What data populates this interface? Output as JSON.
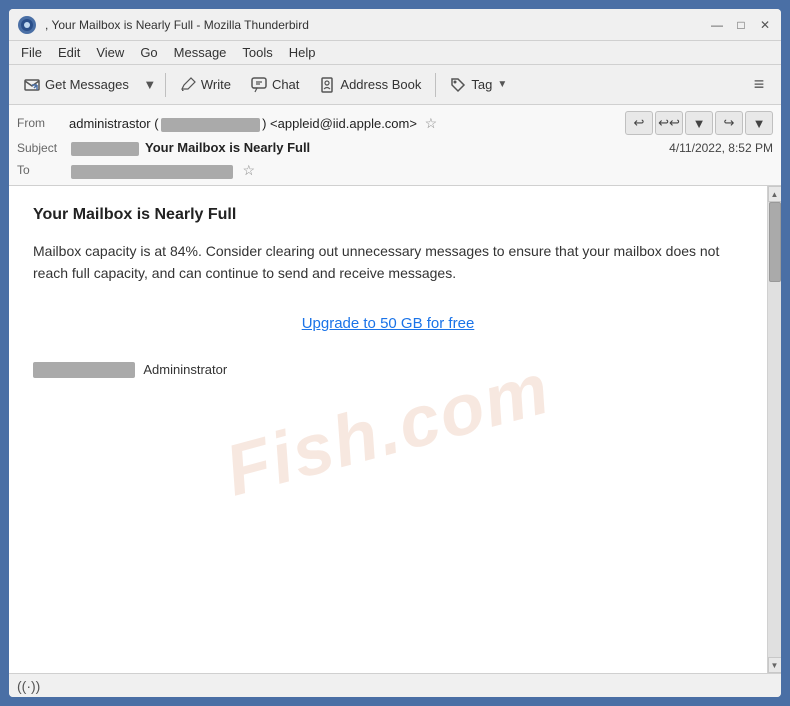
{
  "window": {
    "title": ", Your Mailbox is Nearly Full - Mozilla Thunderbird",
    "min_btn": "—",
    "max_btn": "□",
    "close_btn": "✕"
  },
  "menubar": {
    "items": [
      "File",
      "Edit",
      "View",
      "Go",
      "Message",
      "Tools",
      "Help"
    ]
  },
  "toolbar": {
    "get_messages_label": "Get Messages",
    "write_label": "Write",
    "chat_label": "Chat",
    "address_book_label": "Address Book",
    "tag_label": "Tag",
    "menu_icon": "≡"
  },
  "email": {
    "from_label": "From",
    "from_value": "administrastor (",
    "from_email": ") <appleid@iid.apple.com>",
    "subject_label": "Subject",
    "subject_prefix": "",
    "subject_main": "Your Mailbox is Nearly Full",
    "subject_date": "4/11/2022, 8:52 PM",
    "to_label": "To",
    "to_value": ""
  },
  "body": {
    "title": "Your Mailbox is Nearly Full",
    "paragraph": "Mailbox capacity is at 84%. Consider clearing out unnecessary messages to ensure that your mailbox does not reach full capacity, and can continue to send and receive messages.",
    "upgrade_link": "Upgrade to 50 GB for free",
    "watermark": "Fish.com",
    "signature_name": "Admininstrator"
  },
  "statusbar": {
    "signal_icon": "((·))"
  }
}
